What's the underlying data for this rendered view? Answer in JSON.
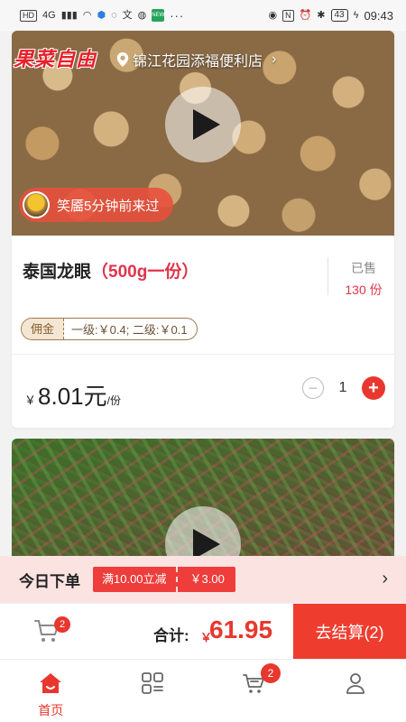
{
  "status_bar": {
    "network": "HD",
    "signal": "4G",
    "news_badge": "NEWS",
    "more": "···",
    "battery": "43",
    "time": "09:43"
  },
  "hero": {
    "brand": "果菜自由",
    "store_name": "锦江花园添福便利店",
    "visitor_text": "笑靥5分钟前来过"
  },
  "product": {
    "name": "泰国龙眼",
    "spec": "（500g一份）",
    "sold_label": "已售",
    "sold_count": "130 份",
    "commission_tag": "佣金",
    "commission_text": "一级:￥0.4;  二级:￥0.1",
    "currency": "￥",
    "price": "8.01元",
    "unit": "/份",
    "minus": "−",
    "quantity": "1",
    "plus": "+"
  },
  "promo": {
    "title": "今日下单",
    "coupon_condition": "满10.00立减",
    "coupon_amount": "￥3.00"
  },
  "checkout": {
    "cart_badge": "2",
    "total_label": "合计:",
    "currency": "￥",
    "total": "61.95",
    "button": "去结算(2)"
  },
  "tabs": {
    "home_label": "首页",
    "cart_badge": "2"
  },
  "colors": {
    "accent": "#e8372e",
    "price_red": "#e0344b",
    "promo_bg": "#fbe3e2"
  }
}
